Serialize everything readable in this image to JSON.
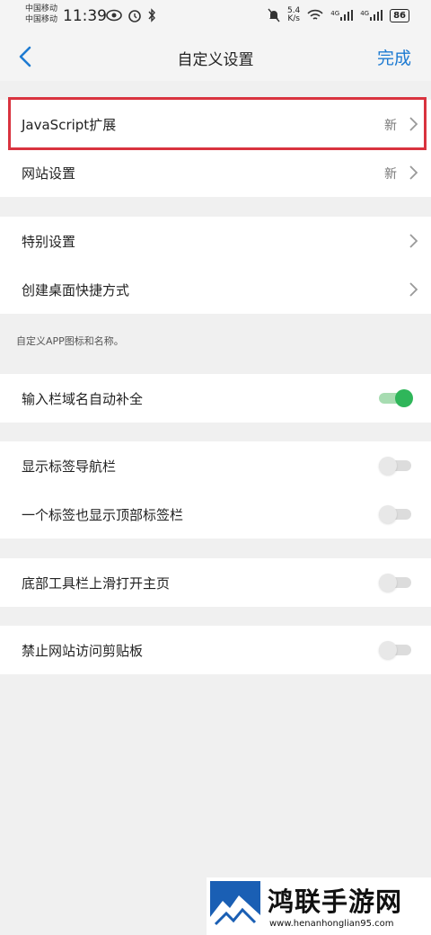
{
  "status_bar": {
    "carrier_1": "中国移动",
    "carrier_2": "中国移动",
    "time": "11:39",
    "net_speed_value": "5.4",
    "net_speed_unit": "K/s",
    "sig1_label": "4G",
    "sig2_label": "4G",
    "battery": "86"
  },
  "nav": {
    "title": "自定义设置",
    "done_label": "完成"
  },
  "group1": [
    {
      "label": "JavaScript扩展",
      "badge": "新"
    },
    {
      "label": "网站设置",
      "badge": "新"
    }
  ],
  "group2": [
    {
      "label": "特别设置"
    },
    {
      "label": "创建桌面快捷方式"
    }
  ],
  "group2_note": "自定义APP图标和名称。",
  "toggles": [
    {
      "label": "输入栏域名自动补全",
      "on": true
    },
    {
      "label": "显示标签导航栏",
      "on": false
    },
    {
      "label": "一个标签也显示顶部标签栏",
      "on": false
    },
    {
      "label": "底部工具栏上滑打开主页",
      "on": false
    },
    {
      "label": "禁止网站访问剪贴板",
      "on": false
    }
  ],
  "colors": {
    "accent": "#1e7bd2",
    "toggle_on": "#2fb65a",
    "highlight": "#d9333f",
    "background": "#f0f0f0"
  },
  "watermark": {
    "name": "鸿联手游网",
    "url": "www.henanhonglian95.com"
  }
}
